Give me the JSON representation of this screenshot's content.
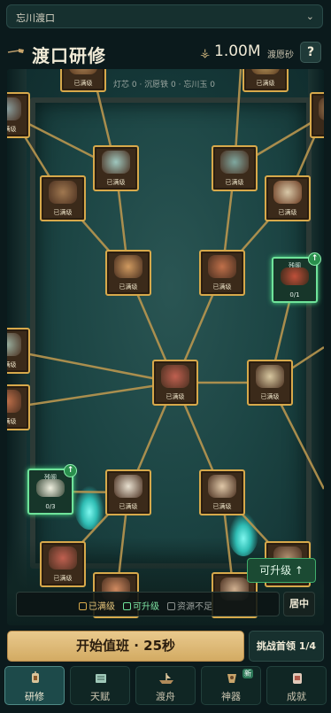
{
  "topbar": {
    "location": "忘川渡口",
    "chevron": "⌄"
  },
  "header": {
    "title": "渡口研修",
    "currency_icon": "⚶",
    "amount": "1.00M",
    "unit": "渡愿砂",
    "help": "?"
  },
  "board": {
    "stats_text": "灯芯 0 · 沉愿铁 0 · 忘川玉 0"
  },
  "nodes": [
    {
      "label": "已满级",
      "state": "maxed",
      "tag": ""
    },
    {
      "label": "已满级",
      "state": "maxed",
      "tag": ""
    },
    {
      "label": "已满级",
      "state": "maxed",
      "tag": ""
    },
    {
      "label": "已满级",
      "state": "maxed",
      "tag": ""
    },
    {
      "label": "已满级",
      "state": "maxed",
      "tag": ""
    },
    {
      "label": "已满级",
      "state": "maxed",
      "tag": ""
    },
    {
      "label": "已满级",
      "state": "maxed",
      "tag": ""
    },
    {
      "label": "已满级",
      "state": "maxed",
      "tag": ""
    },
    {
      "label": "0/1",
      "state": "upgradable",
      "tag": "残阁"
    },
    {
      "label": "已满级",
      "state": "maxed",
      "tag": ""
    },
    {
      "label": "已满级",
      "state": "maxed",
      "tag": ""
    },
    {
      "label": "已满级",
      "state": "maxed",
      "tag": ""
    },
    {
      "label": "已满级",
      "state": "maxed",
      "tag": ""
    },
    {
      "label": "0/3",
      "state": "upgradable",
      "tag": "残阁"
    },
    {
      "label": "已满级",
      "state": "maxed",
      "tag": ""
    },
    {
      "label": "已满级",
      "state": "maxed",
      "tag": ""
    },
    {
      "label": "已满级",
      "state": "maxed",
      "tag": ""
    },
    {
      "label": "已满级",
      "state": "maxed",
      "tag": ""
    },
    {
      "label": "已满级",
      "state": "maxed",
      "tag": ""
    }
  ],
  "upgradable_button": "可升级 ↑",
  "legend": {
    "maxed": "已满级",
    "upgradable": "可升级",
    "insufficient": "资源不足",
    "colors": {
      "maxed": "#d7a94b",
      "upgradable": "#6fe39a",
      "insufficient": "#8a8f8c"
    }
  },
  "center_button": "居中",
  "actions": {
    "start": "开始值班 · 25秒",
    "challenge": "挑战首领 1/4"
  },
  "tabs": [
    {
      "label": "研修",
      "icon": "lantern-icon",
      "active": true,
      "badge": ""
    },
    {
      "label": "天赋",
      "icon": "scroll-icon",
      "active": false,
      "badge": ""
    },
    {
      "label": "渡舟",
      "icon": "boat-icon",
      "active": false,
      "badge": ""
    },
    {
      "label": "神器",
      "icon": "artifact-icon",
      "active": false,
      "badge": "新"
    },
    {
      "label": "成就",
      "icon": "trophy-icon",
      "active": false,
      "badge": ""
    }
  ]
}
